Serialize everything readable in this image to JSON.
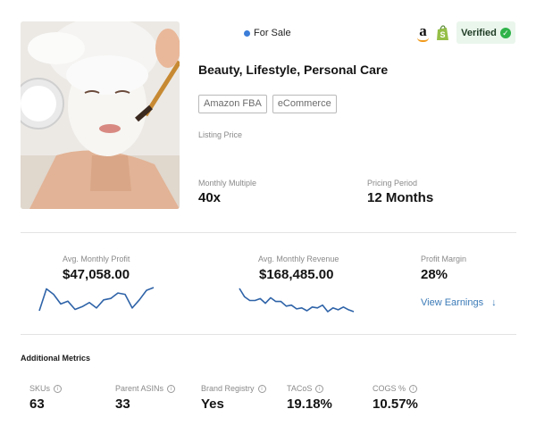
{
  "listing": {
    "status": "For Sale",
    "verified_label": "Verified",
    "title": "Beauty, Lifestyle, Personal Care",
    "tags": [
      "Amazon FBA",
      "eCommerce"
    ],
    "listing_price_label": "Listing Price",
    "monthly_multiple_label": "Monthly Multiple",
    "monthly_multiple_value": "40x",
    "pricing_period_label": "Pricing Period",
    "pricing_period_value": "12 Months",
    "status_color": "#3b7dd8",
    "verified_color": "#2fb34a"
  },
  "financials": {
    "profit_label": "Avg. Monthly Profit",
    "profit_value": "$47,058.00",
    "revenue_label": "Avg. Monthly Revenue",
    "revenue_value": "$168,485.00",
    "margin_label": "Profit Margin",
    "margin_value": "28%",
    "view_earnings_label": "View Earnings",
    "view_earnings_arrow": "↓",
    "profit_trend": [
      10,
      26,
      22,
      15,
      17,
      11,
      13,
      16,
      12,
      18,
      19,
      23,
      22,
      12,
      18,
      25,
      27
    ],
    "revenue_trend": [
      27,
      18,
      14,
      14,
      16,
      11,
      17,
      13,
      13,
      8,
      9,
      5,
      6,
      3,
      7,
      6,
      9,
      2,
      6,
      4,
      7,
      4,
      2
    ],
    "trend_color": "#2e63a8"
  },
  "additional": {
    "title": "Additional Metrics",
    "metrics": [
      {
        "label": "SKUs",
        "value": "63"
      },
      {
        "label": "Parent ASINs",
        "value": "33"
      },
      {
        "label": "Brand Registry",
        "value": "Yes"
      },
      {
        "label": "TACoS",
        "value": "19.18%"
      },
      {
        "label": "COGS %",
        "value": "10.57%"
      }
    ],
    "info_glyph": "i"
  }
}
